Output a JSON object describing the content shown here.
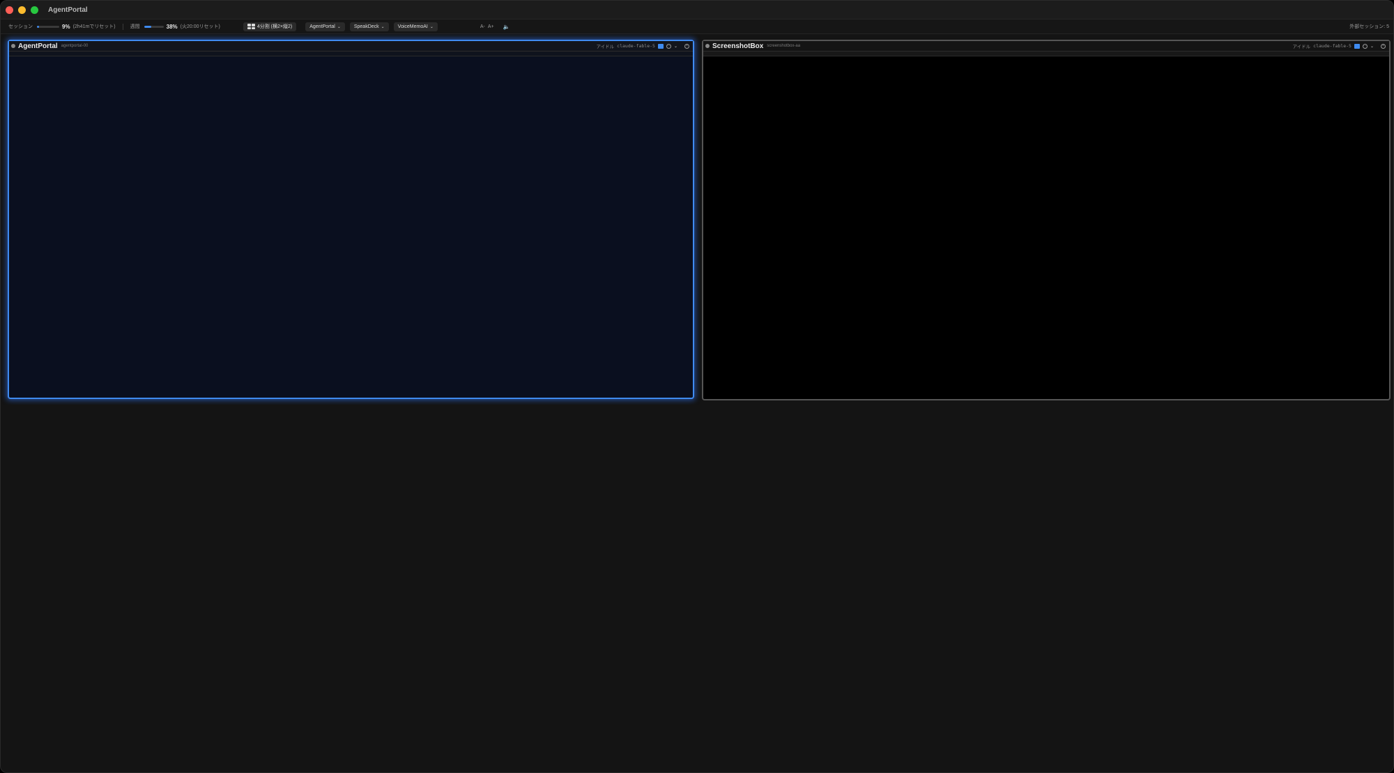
{
  "window": {
    "title": "AgentPortal",
    "traffic_lights": {
      "close": "#ff5f57",
      "minimize": "#febc2e",
      "zoom": "#28c840"
    }
  },
  "toolbar": {
    "session": {
      "label": "セッション",
      "percent_text": "9%",
      "value": 9,
      "reset_text": "(2h41mでリセット)"
    },
    "weekly": {
      "label": "週間",
      "percent_text": "38%",
      "value": 38,
      "reset_text": "(火20:00リセット)"
    },
    "layout_button": {
      "label": "4分割 (横2×縦2)",
      "icon": "grid-icon"
    },
    "project_buttons": [
      {
        "label": "AgentPortal"
      },
      {
        "label": "SpeakDeck"
      },
      {
        "label": "VoiceMemoAI"
      }
    ],
    "font_controls": {
      "decrease": "A-",
      "increase": "A+"
    },
    "sound_icon": "speaker-icon",
    "external_sessions": "外部セッション: 5"
  },
  "panels": [
    {
      "name": "AgentPortal",
      "id": "agentportal-00",
      "status": "アイドル",
      "agent": "claude-fable-5",
      "active": true,
      "accent": "#3f8bf0"
    },
    {
      "name": "ScreenshotBox",
      "id": "screenshotbox-aa",
      "status": "アイドル",
      "agent": "claude-fable-5",
      "active": false,
      "accent": "#555555"
    }
  ]
}
